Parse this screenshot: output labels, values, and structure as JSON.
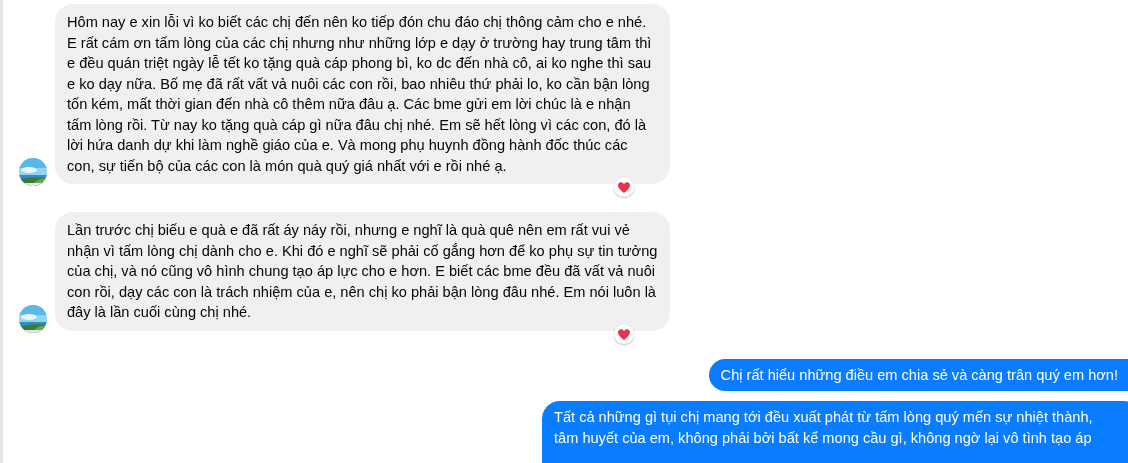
{
  "messages": [
    {
      "kind": "incoming",
      "heart_reaction": true,
      "text": "Hôm nay e xin lỗi vì ko biết các chị đến nên ko tiếp đón chu đáo chị thông cảm cho e nhé. E rất cám ơn tấm lòng của các chị nhưng như những lớp e dạy ở trường hay trung tâm thì e đều quán triệt ngày lễ tết ko tặng quà cáp phong bì, ko dc đến nhà cô, ai ko nghe thì sau e ko dạy nữa. Bố mẹ đã rất vất vả nuôi các con rồi, bao nhiêu thứ phải lo, ko cần bận lòng tốn kém, mất thời gian đến nhà cô thêm nữa đâu ạ.  Các bme gửi em lời chúc là e nhận tấm lòng rồi. Từ nay ko tặng quà cáp gì nữa đâu chị nhé. Em sẽ hết lòng vì các con, đó là lời hứa danh dự khi làm nghề giáo của e. Và mong phụ huynh đồng hành đốc thúc các con, sự tiến bộ của các con là món quà quý giá nhất với e rồi nhé ạ."
    },
    {
      "kind": "incoming",
      "heart_reaction": true,
      "text": "Lần trước chị biếu e quà e đã rất áy náy rồi, nhưng e nghĩ là quà quê nên em rất vui vẻ nhận vì tấm lòng chị dành cho e. Khi đó e nghĩ sẽ phải cố gắng hơn để ko phụ sự tin tưởng của chị, và nó cũng vô hình chung tạo áp lực cho e hơn. E biết các bme đều đã vất vả nuôi con rồi, dạy các con là trách nhiệm của e, nên chị ko phải bận lòng đâu nhé. Em nói luôn là đây là lần cuối cùng chị nhé."
    },
    {
      "kind": "outgoing",
      "text": "Chị rất hiểu những điều em chia sẻ và càng trân quý em hơn!"
    },
    {
      "kind": "outgoing",
      "text": "Tất cả những gì tụi chị mang tới đều xuất phát từ tấm lòng quý mến sự nhiệt thành, tâm huyết của em, không phải bởi bất kể mong cầu gì, không ngờ lại vô tình tạo áp"
    }
  ]
}
